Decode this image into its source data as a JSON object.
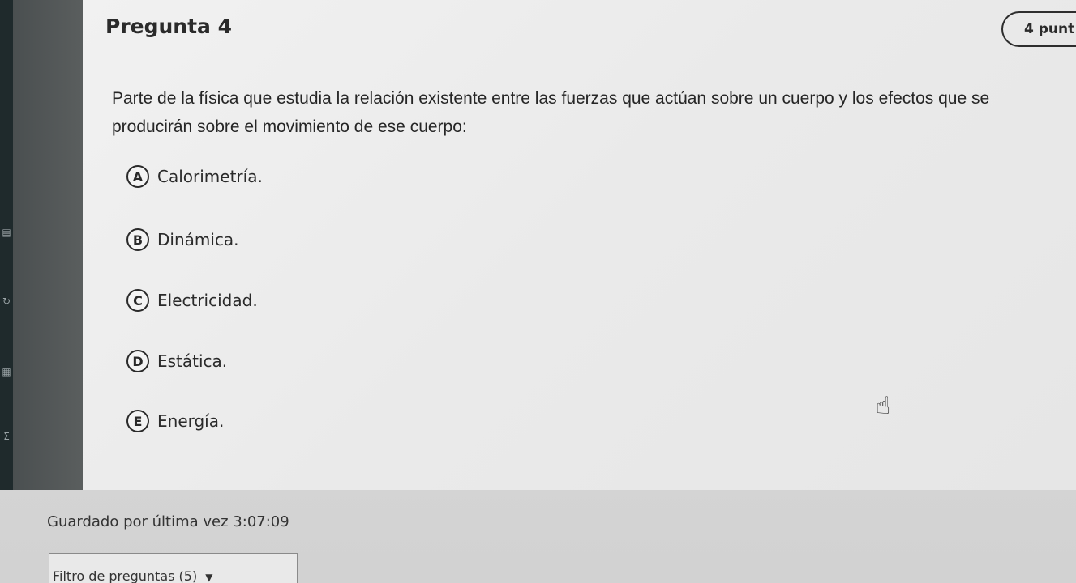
{
  "question": {
    "title": "Pregunta 4",
    "points": "4 punt",
    "text": "Parte de la física que estudia la relación existente entre las fuerzas que actúan sobre un cuerpo y los efectos que se producirán sobre el movimiento de ese cuerpo:"
  },
  "options": [
    {
      "letter": "A",
      "text": "Calorimetría."
    },
    {
      "letter": "B",
      "text": "Dinámica."
    },
    {
      "letter": "C",
      "text": "Electricidad."
    },
    {
      "letter": "D",
      "text": "Estática."
    },
    {
      "letter": "E",
      "text": "Energía."
    }
  ],
  "footer": {
    "saved_text": "Guardado por última vez 3:07:09",
    "filter_label": "Filtro de preguntas (5)",
    "filter_caret": "▼"
  },
  "icons": {
    "cursor": "hand-pointer-icon"
  }
}
